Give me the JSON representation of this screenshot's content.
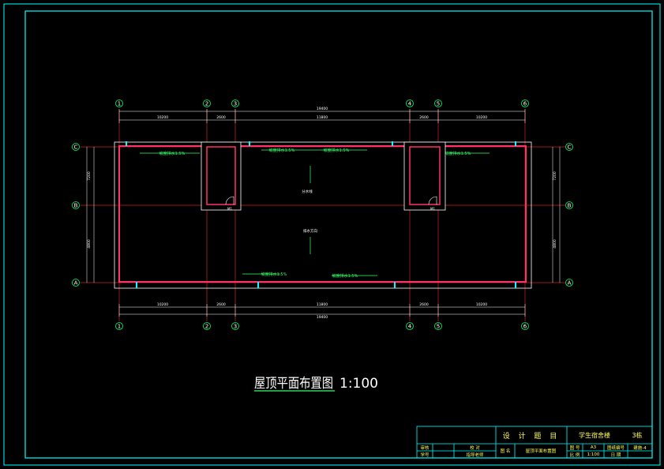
{
  "sheet": {
    "colors": {
      "background": "#000000",
      "frame": "#00ffff",
      "wall": "#ff3366",
      "axis": "#ff3333",
      "dimension": "#00ff66",
      "text": "#ffff55",
      "white": "#ffffff",
      "slope": "#33ff66"
    }
  },
  "axes": {
    "columns": [
      "1",
      "2",
      "3",
      "4",
      "5",
      "6"
    ],
    "rows": [
      "C",
      "B",
      "A"
    ]
  },
  "dimensions": {
    "top_total": "19400",
    "top_segments": [
      "10200",
      "2600",
      "20400",
      "2600",
      "10200"
    ],
    "top_middle": "11800",
    "bottom_total": "19400",
    "bottom_segments": [
      "10200",
      "2600",
      "11800",
      "2600",
      "10200"
    ],
    "left_segments": [
      "7200",
      "4800"
    ],
    "right_segments": [
      "7200",
      "4800"
    ]
  },
  "annotations": {
    "slope_labels": [
      "坡度排水1.5%",
      "坡度排水1.5%",
      "坡度排水1.5%",
      "坡度排水1.5%",
      "坡度排水1.5%",
      "坡度排水1.5%"
    ],
    "center_up": "分水线",
    "center_down": "排水方向",
    "door_label_left": "M1",
    "door_label_right": "M1"
  },
  "title": {
    "main": "屋顶平面布置图",
    "scale": "1:100"
  },
  "title_block": {
    "review": "审核",
    "check": "校 对",
    "student_id": "学号",
    "student_name": "指导老师",
    "design_title_label": "设 计 题 目",
    "project_name": "学生宿舍楼",
    "group": "3栋",
    "drawing_name_label": "图 名",
    "drawing_name": "屋顶平面布置图",
    "sheet_label": "图 号",
    "sheet_value": "A3",
    "drawing_no_label": "图纸编号",
    "drawing_no": "建施-4",
    "scale_label": "比 例",
    "scale_value": "1:100",
    "date_label": "日 期"
  }
}
